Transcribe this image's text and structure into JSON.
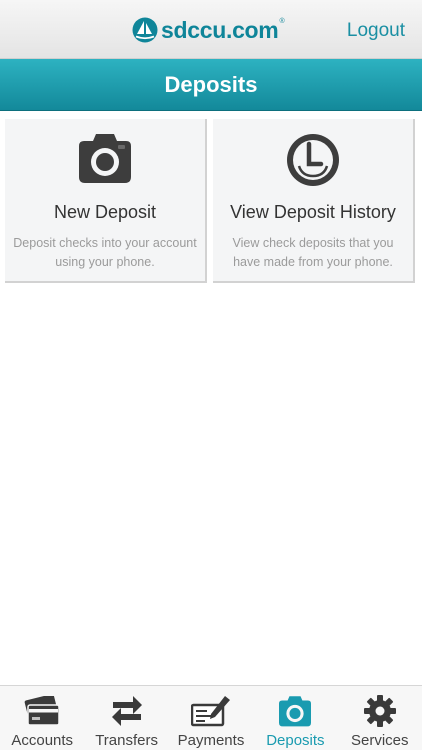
{
  "header": {
    "brand": "sdccu.com",
    "brand_mark": "®",
    "logo_icon": "sailboat-logo-icon",
    "logout_label": "Logout"
  },
  "page": {
    "title": "Deposits"
  },
  "tiles": [
    {
      "icon": "camera-icon",
      "title": "New Deposit",
      "description": "Deposit checks into your account using your phone."
    },
    {
      "icon": "clock-history-icon",
      "title": "View Deposit History",
      "description": "View check deposits that you have made from your phone."
    }
  ],
  "tabbar": {
    "active": "Deposits",
    "items": [
      {
        "label": "Accounts",
        "icon": "credit-card-icon"
      },
      {
        "label": "Transfers",
        "icon": "transfer-arrows-icon"
      },
      {
        "label": "Payments",
        "icon": "check-pen-icon"
      },
      {
        "label": "Deposits",
        "icon": "camera-icon"
      },
      {
        "label": "Services",
        "icon": "gear-icon"
      }
    ]
  },
  "colors": {
    "brand_teal": "#0f8599",
    "title_bar": "#1a9bb0",
    "active_tab": "#1a9bb0",
    "icon_dark": "#3a3a3a"
  }
}
